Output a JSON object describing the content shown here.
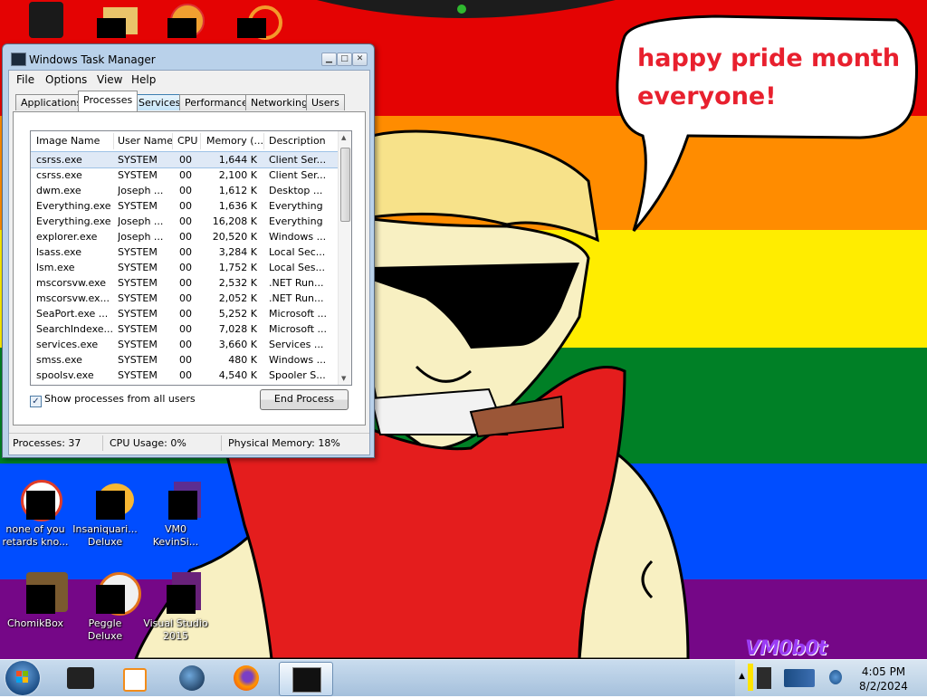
{
  "desktop": {
    "bubble_text_line1": "happy pride month",
    "bubble_text_line2": "everyone!",
    "watermark": "VM0b0t",
    "icons": [
      {
        "label": "none of you retards kno...",
        "icon": "browser-icon"
      },
      {
        "label": "Insaniquari... Deluxe",
        "icon": "game-fish-icon"
      },
      {
        "label": "VM0 KevinSi...",
        "icon": "purple-app-icon"
      },
      {
        "label": "ChomikBox",
        "icon": "chomikbox-icon"
      },
      {
        "label": "Peggle Deluxe",
        "icon": "peggle-icon"
      },
      {
        "label": "Visual Studio 2015",
        "icon": "visual-studio-icon"
      }
    ]
  },
  "task_manager": {
    "title": "Windows Task Manager",
    "menu": [
      "File",
      "Options",
      "View",
      "Help"
    ],
    "tabs": [
      "Applications",
      "Processes",
      "Services",
      "Performance",
      "Networking",
      "Users"
    ],
    "active_tab": "Processes",
    "columns": [
      "Image Name",
      "User Name",
      "CPU",
      "Memory (...",
      "Description"
    ],
    "rows": [
      [
        "csrss.exe",
        "SYSTEM",
        "00",
        "1,644 K",
        "Client Ser..."
      ],
      [
        "csrss.exe",
        "SYSTEM",
        "00",
        "2,100 K",
        "Client Ser..."
      ],
      [
        "dwm.exe",
        "Joseph ...",
        "00",
        "1,612 K",
        "Desktop ..."
      ],
      [
        "Everything.exe",
        "SYSTEM",
        "00",
        "1,636 K",
        "Everything"
      ],
      [
        "Everything.exe",
        "Joseph ...",
        "00",
        "16,208 K",
        "Everything"
      ],
      [
        "explorer.exe",
        "Joseph ...",
        "00",
        "20,520 K",
        "Windows ..."
      ],
      [
        "lsass.exe",
        "SYSTEM",
        "00",
        "3,284 K",
        "Local Sec..."
      ],
      [
        "lsm.exe",
        "SYSTEM",
        "00",
        "1,752 K",
        "Local Ses..."
      ],
      [
        "mscorsvw.exe",
        "SYSTEM",
        "00",
        "2,532 K",
        ".NET Run..."
      ],
      [
        "mscorsvw.ex...",
        "SYSTEM",
        "00",
        "2,052 K",
        ".NET Run..."
      ],
      [
        "SeaPort.exe ...",
        "SYSTEM",
        "00",
        "5,252 K",
        "Microsoft ..."
      ],
      [
        "SearchIndexe...",
        "SYSTEM",
        "00",
        "7,028 K",
        "Microsoft ..."
      ],
      [
        "services.exe",
        "SYSTEM",
        "00",
        "3,660 K",
        "Services ..."
      ],
      [
        "smss.exe",
        "SYSTEM",
        "00",
        "480 K",
        "Windows ..."
      ],
      [
        "spoolsv.exe",
        "SYSTEM",
        "00",
        "4,540 K",
        "Spooler S..."
      ]
    ],
    "show_all_label": "Show processes from all users",
    "show_all_checked": true,
    "end_process_label": "End Process",
    "status": {
      "processes": "Processes: 37",
      "cpu": "CPU Usage: 0%",
      "memory": "Physical Memory: 18%"
    }
  },
  "taskbar": {
    "pinned": [
      "file-manager-icon",
      "media-player-icon",
      "globe-icon",
      "firefox-icon",
      "task-manager-icon"
    ],
    "time": "4:05 PM",
    "date": "8/2/2024"
  },
  "colors": {
    "rainbow": [
      "#e40303",
      "#ff8c00",
      "#ffed00",
      "#008026",
      "#004dff",
      "#750787"
    ],
    "bubble_text": "#e8202e"
  }
}
